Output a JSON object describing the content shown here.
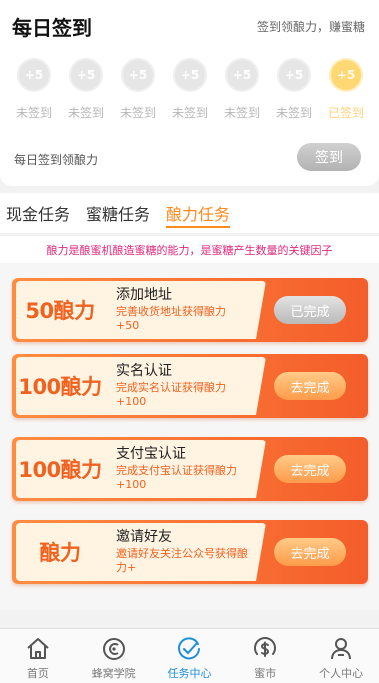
{
  "signin": {
    "title": "每日签到",
    "subtitle": "签到领酿力，赚蜜糖",
    "days": [
      {
        "reward": "+5",
        "label": "未签到",
        "signed": false
      },
      {
        "reward": "+5",
        "label": "未签到",
        "signed": false
      },
      {
        "reward": "+5",
        "label": "未签到",
        "signed": false
      },
      {
        "reward": "+5",
        "label": "未签到",
        "signed": false
      },
      {
        "reward": "+5",
        "label": "未签到",
        "signed": false
      },
      {
        "reward": "+5",
        "label": "未签到",
        "signed": false
      },
      {
        "reward": "+5",
        "label": "已签到",
        "signed": true
      }
    ],
    "footer_text": "每日签到领酿力",
    "button_label": "签到"
  },
  "tabs": [
    {
      "label": "现金任务",
      "active": false
    },
    {
      "label": "蜜糖任务",
      "active": false
    },
    {
      "label": "酿力任务",
      "active": true
    }
  ],
  "notice": "酿力是酿蜜机酿造蜜糖的能力，是蜜糖产生数量的关键因子",
  "tasks": [
    {
      "amount": "50酿力",
      "name": "添加地址",
      "desc": "完善收货地址获得酿力+50",
      "button": "已完成",
      "done": true
    },
    {
      "amount": "100酿力",
      "name": "实名认证",
      "desc": "完成实名认证获得酿力+100",
      "button": "去完成",
      "done": false
    },
    {
      "amount": "100酿力",
      "name": "支付宝认证",
      "desc": "完成支付宝认证获得酿力+100",
      "button": "去完成",
      "done": false
    },
    {
      "amount": "酿力",
      "name": "邀请好友",
      "desc": "邀请好友关注公众号获得酿力+",
      "button": "去完成",
      "done": false
    }
  ],
  "bottom_nav": [
    {
      "label": "首页",
      "icon": "home-icon",
      "active": false
    },
    {
      "label": "蜂窝学院",
      "icon": "hive-college-icon",
      "active": false
    },
    {
      "label": "任务中心",
      "icon": "task-center-icon",
      "active": true
    },
    {
      "label": "蜜市",
      "icon": "market-icon",
      "active": false
    },
    {
      "label": "个人中心",
      "icon": "profile-icon",
      "active": false
    }
  ],
  "colors": {
    "accent": "#ff8a1e",
    "notice": "#e0297d",
    "task_gradient_start": "#ff8d41",
    "task_gradient_end": "#f45d2a",
    "nav_active": "#1d8fd8"
  }
}
